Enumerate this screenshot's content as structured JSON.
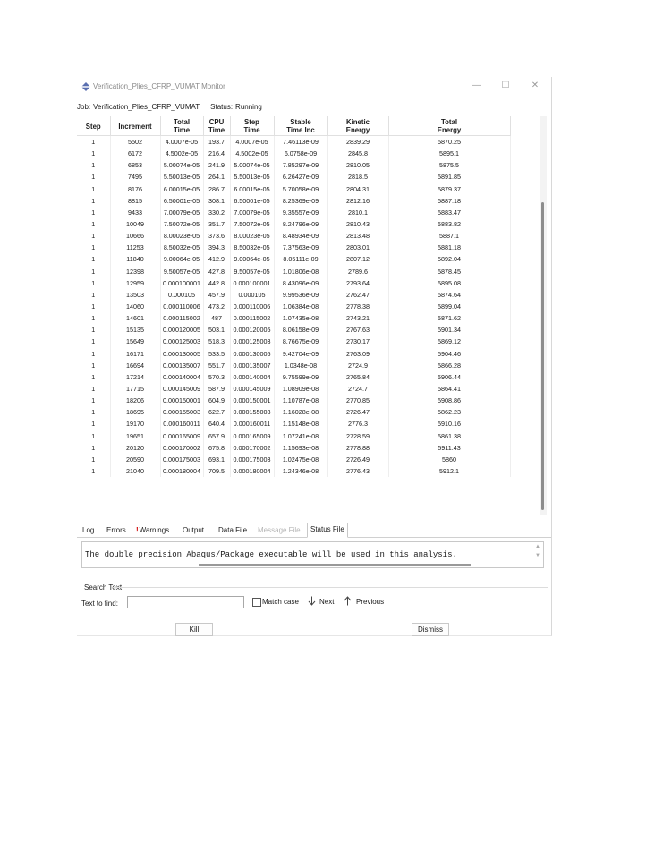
{
  "window": {
    "title": "Verification_Plies_CFRP_VUMAT Monitor",
    "minimize_glyph": "—",
    "maximize_glyph": "☐",
    "close_glyph": "✕",
    "icon": "abaqus-app-icon"
  },
  "job": {
    "job_label": "Job:",
    "job_name": "Verification_Plies_CFRP_VUMAT",
    "status_label": "Status:",
    "status_value": "Running"
  },
  "table": {
    "headers": [
      [
        "Step",
        ""
      ],
      [
        "Increment",
        ""
      ],
      [
        "Total",
        "Time"
      ],
      [
        "CPU",
        "Time"
      ],
      [
        "Step",
        "Time"
      ],
      [
        "Stable",
        "Time Inc"
      ],
      [
        "Kinetic",
        "Energy"
      ],
      [
        "Total",
        "Energy"
      ]
    ],
    "rows": [
      [
        "1",
        "5502",
        "4.0007e-05",
        "193.7",
        "4.0007e-05",
        "7.46113e-09",
        "2839.29",
        "5870.25"
      ],
      [
        "1",
        "6172",
        "4.5002e-05",
        "216.4",
        "4.5002e-05",
        "6.0758e-09",
        "2845.8",
        "5895.1"
      ],
      [
        "1",
        "6853",
        "5.00074e-05",
        "241.9",
        "5.00074e-05",
        "7.85297e-09",
        "2810.05",
        "5875.5"
      ],
      [
        "1",
        "7495",
        "5.50013e-05",
        "264.1",
        "5.50013e-05",
        "6.26427e-09",
        "2818.5",
        "5891.85"
      ],
      [
        "1",
        "8176",
        "6.00015e-05",
        "286.7",
        "6.00015e-05",
        "5.70058e-09",
        "2804.31",
        "5879.37"
      ],
      [
        "1",
        "8815",
        "6.50001e-05",
        "308.1",
        "6.50001e-05",
        "8.25369e-09",
        "2812.16",
        "5887.18"
      ],
      [
        "1",
        "9433",
        "7.00079e-05",
        "330.2",
        "7.00079e-05",
        "9.35557e-09",
        "2810.1",
        "5883.47"
      ],
      [
        "1",
        "10049",
        "7.50072e-05",
        "351.7",
        "7.50072e-05",
        "8.24796e-09",
        "2810.43",
        "5883.82"
      ],
      [
        "1",
        "10666",
        "8.00023e-05",
        "373.6",
        "8.00023e-05",
        "8.48934e-09",
        "2813.48",
        "5887.1"
      ],
      [
        "1",
        "11253",
        "8.50032e-05",
        "394.3",
        "8.50032e-05",
        "7.37563e-09",
        "2803.01",
        "5881.18"
      ],
      [
        "1",
        "11840",
        "9.00064e-05",
        "412.9",
        "9.00064e-05",
        "8.05111e-09",
        "2807.12",
        "5892.04"
      ],
      [
        "1",
        "12398",
        "9.50057e-05",
        "427.8",
        "9.50057e-05",
        "1.01806e-08",
        "2789.6",
        "5878.45"
      ],
      [
        "1",
        "12959",
        "0.000100001",
        "442.8",
        "0.000100001",
        "8.43096e-09",
        "2793.64",
        "5895.08"
      ],
      [
        "1",
        "13503",
        "0.000105",
        "457.9",
        "0.000105",
        "9.99536e-09",
        "2762.47",
        "5874.64"
      ],
      [
        "1",
        "14060",
        "0.000110006",
        "473.2",
        "0.000110006",
        "1.06384e-08",
        "2778.38",
        "5899.04"
      ],
      [
        "1",
        "14601",
        "0.000115002",
        "487",
        "0.000115002",
        "1.07435e-08",
        "2743.21",
        "5871.62"
      ],
      [
        "1",
        "15135",
        "0.000120005",
        "503.1",
        "0.000120005",
        "8.06158e-09",
        "2767.63",
        "5901.34"
      ],
      [
        "1",
        "15649",
        "0.000125003",
        "518.3",
        "0.000125003",
        "8.76675e-09",
        "2730.17",
        "5869.12"
      ],
      [
        "1",
        "16171",
        "0.000130005",
        "533.5",
        "0.000130005",
        "9.42704e-09",
        "2763.09",
        "5904.46"
      ],
      [
        "1",
        "16694",
        "0.000135007",
        "551.7",
        "0.000135007",
        "1.0348e-08",
        "2724.9",
        "5866.28"
      ],
      [
        "1",
        "17214",
        "0.000140004",
        "570.3",
        "0.000140004",
        "9.75599e-09",
        "2765.84",
        "5906.44"
      ],
      [
        "1",
        "17715",
        "0.000145009",
        "587.9",
        "0.000145009",
        "1.08909e-08",
        "2724.7",
        "5864.41"
      ],
      [
        "1",
        "18206",
        "0.000150001",
        "604.9",
        "0.000150001",
        "1.10787e-08",
        "2770.85",
        "5908.86"
      ],
      [
        "1",
        "18695",
        "0.000155003",
        "622.7",
        "0.000155003",
        "1.16028e-08",
        "2726.47",
        "5862.23"
      ],
      [
        "1",
        "19170",
        "0.000160011",
        "640.4",
        "0.000160011",
        "1.15148e-08",
        "2776.3",
        "5910.16"
      ],
      [
        "1",
        "19651",
        "0.000165009",
        "657.9",
        "0.000165009",
        "1.07241e-08",
        "2728.59",
        "5861.38"
      ],
      [
        "1",
        "20120",
        "0.000170002",
        "675.8",
        "0.000170002",
        "1.15693e-08",
        "2778.88",
        "5911.43"
      ],
      [
        "1",
        "20590",
        "0.000175003",
        "693.1",
        "0.000175003",
        "1.02475e-08",
        "2726.49",
        "5860"
      ],
      [
        "1",
        "21040",
        "0.000180004",
        "709.5",
        "0.000180004",
        "1.24346e-08",
        "2776.43",
        "5912.1"
      ]
    ]
  },
  "tabs": [
    {
      "label": "Log",
      "state": "normal"
    },
    {
      "label": "Errors",
      "state": "normal"
    },
    {
      "label": "Warnings",
      "state": "normal",
      "mark": "!"
    },
    {
      "label": "Output",
      "state": "normal"
    },
    {
      "label": "Data File",
      "state": "normal"
    },
    {
      "label": "Message File",
      "state": "disabled"
    },
    {
      "label": "Status File",
      "state": "active"
    }
  ],
  "status_file": {
    "text": "The double precision Abaqus/Package executable will be used in this analysis.",
    "scroll_up_glyph": "▲",
    "scroll_down_glyph": "▼"
  },
  "search": {
    "group_label": "Search Text",
    "find_label": "Text to find:",
    "find_value": "",
    "match_case_label": "Match case",
    "match_case_checked": false,
    "next_label": "Next",
    "next_icon": "arrow-down-icon",
    "previous_label": "Previous",
    "previous_icon": "arrow-up-icon"
  },
  "buttons": {
    "kill_label": "Kill",
    "dismiss_label": "Dismiss"
  }
}
